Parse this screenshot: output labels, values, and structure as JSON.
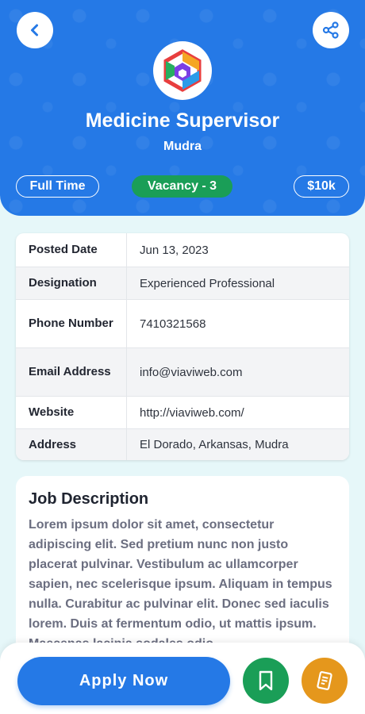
{
  "colors": {
    "primary": "#2579e6",
    "success": "#1a9e57",
    "accent": "#e5971c",
    "background": "#e6f7f9"
  },
  "header": {
    "back_icon": "chevron-left-icon",
    "share_icon": "share-icon",
    "logo": "company-logo",
    "job_title": "Medicine Supervisor",
    "company": "Mudra",
    "job_type": "Full Time",
    "vacancy": "Vacancy - 3",
    "salary": "$10k"
  },
  "details": [
    {
      "label": "Posted Date",
      "value": "Jun 13, 2023"
    },
    {
      "label": "Designation",
      "value": "Experienced Professional"
    },
    {
      "label": "Phone Number",
      "value": "7410321568"
    },
    {
      "label": "Email Address",
      "value": "info@viaviweb.com"
    },
    {
      "label": "Website",
      "value": "http://viaviweb.com/"
    },
    {
      "label": "Address",
      "value": "El Dorado, Arkansas,  Mudra"
    }
  ],
  "job_description": {
    "title": "Job Description",
    "text": "Lorem ipsum dolor sit amet, consectetur adipiscing elit. Sed pretium nunc non justo placerat pulvinar. Vestibulum ac ullamcorper sapien, nec scelerisque ipsum. Aliquam in tempus nulla. Curabitur ac pulvinar elit. Donec sed iaculis lorem. Duis at fermentum odio, ut mattis ipsum. Maecenas lacinia sodales odio."
  },
  "actions": {
    "apply_label": "Apply Now",
    "bookmark_icon": "bookmark-icon",
    "document_icon": "document-icon"
  }
}
